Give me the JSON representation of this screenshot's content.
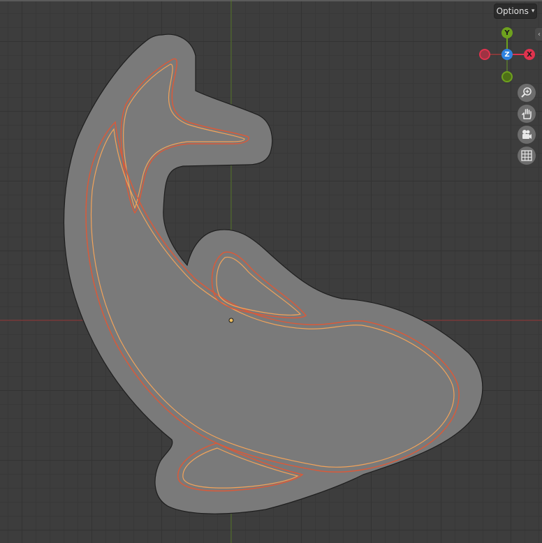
{
  "header": {
    "options_label": "Options",
    "options_chevron": "chevron-down-icon",
    "collapse_icon": "chevron-left-icon"
  },
  "gizmo": {
    "axes": [
      {
        "name": "Y",
        "color": "#6ea11e"
      },
      {
        "name": "Z",
        "color": "#2f82e0"
      },
      {
        "name": "X",
        "color": "#e0334e"
      },
      {
        "name": "-X",
        "color": "#e0334e"
      },
      {
        "name": "-Y",
        "color": "#6ea11e"
      }
    ]
  },
  "nav_buttons": [
    {
      "icon": "zoom-icon"
    },
    {
      "icon": "hand-pan-icon"
    },
    {
      "icon": "camera-icon"
    },
    {
      "icon": "grid-icon"
    }
  ],
  "colors": {
    "background": "#3d3d3d",
    "shape_fill": "#7a7a7a",
    "outline_red": "#d95a3a",
    "outline_orange": "#f2a35a",
    "axis_x": "#9b3b3b",
    "axis_y": "#5a7a2e"
  }
}
